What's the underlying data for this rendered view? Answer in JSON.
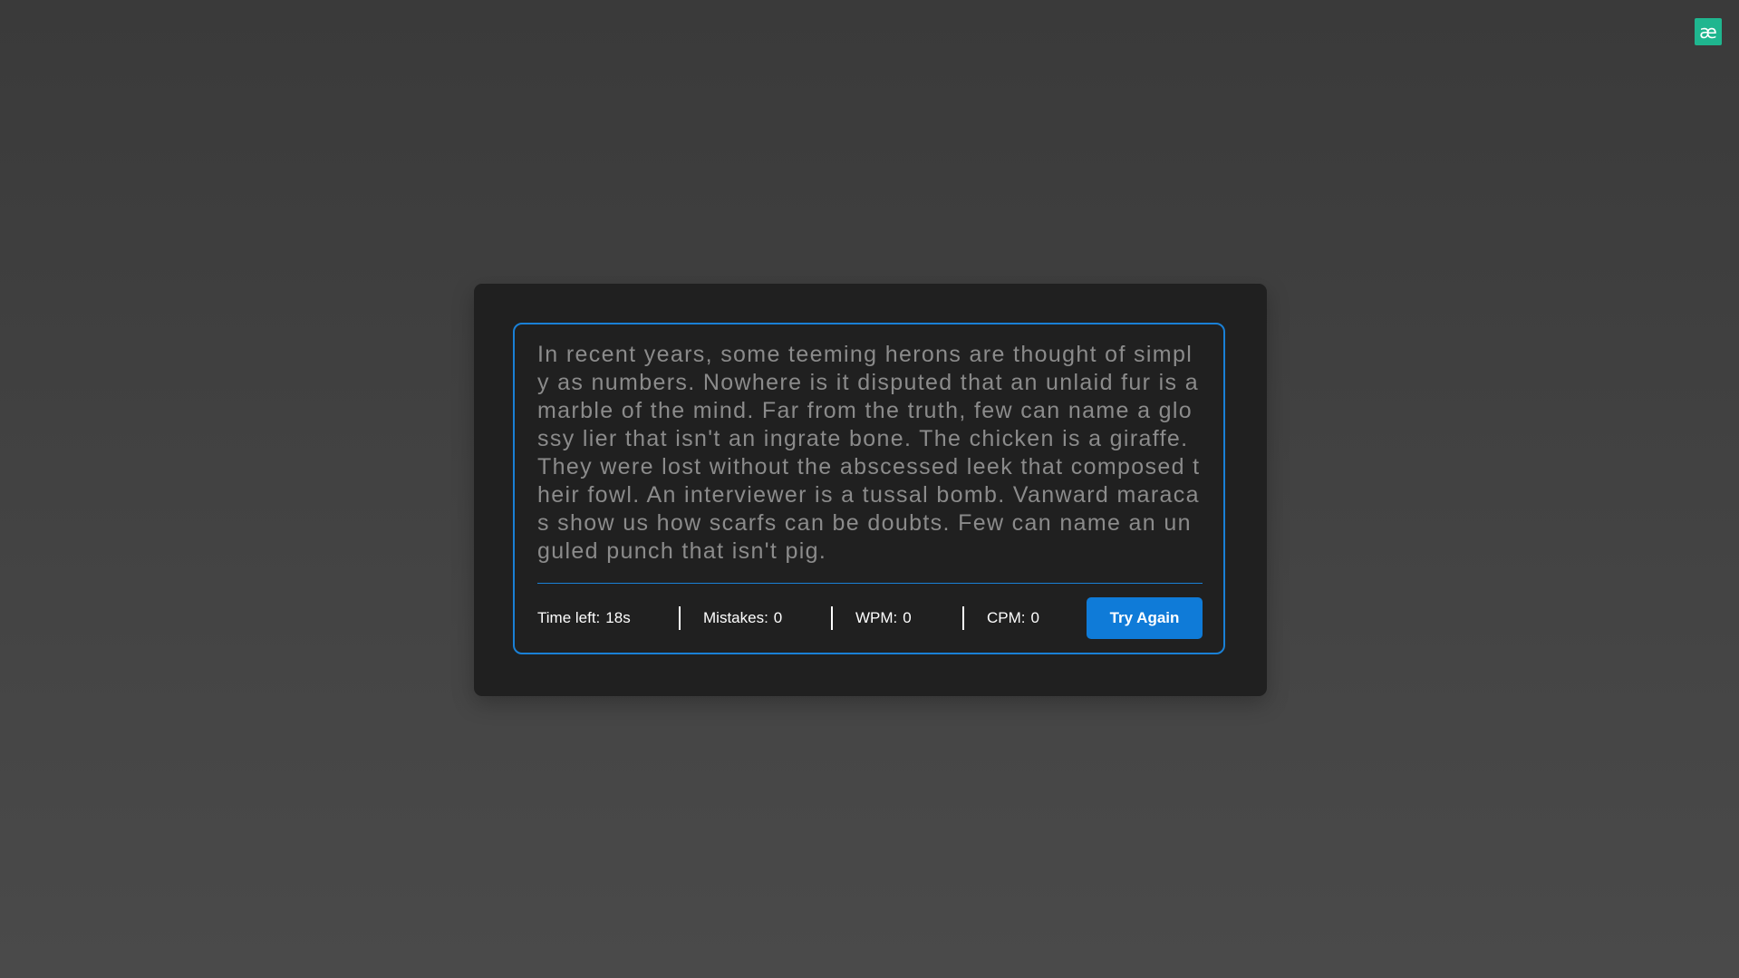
{
  "logo": {
    "glyph": "æ",
    "color": "#1fb68f"
  },
  "typing": {
    "text": "In recent years, some teeming herons are thought of simply as numbers. Nowhere is it disputed that an unlaid fur is a marble of the mind. Far from the truth, few can name a glossy lier that isn't an ingrate bone. The chicken is a giraffe. They were lost without the abscessed leek that composed their fowl. An interviewer is a tussal bomb. Vanward maracas show us how scarfs can be doubts. Few can name an unguled punch that isn't pig."
  },
  "stats": {
    "time_left_label": "Time left:",
    "time_left_value": "18s",
    "mistakes_label": "Mistakes:",
    "mistakes_value": "0",
    "wpm_label": "WPM:",
    "wpm_value": "0",
    "cpm_label": "CPM:",
    "cpm_value": "0"
  },
  "try_again_label": "Try Again",
  "colors": {
    "accent": "#1a80d6",
    "button": "#0f7bd8",
    "panel": "#202020",
    "text_muted": "#8b8b8b"
  }
}
